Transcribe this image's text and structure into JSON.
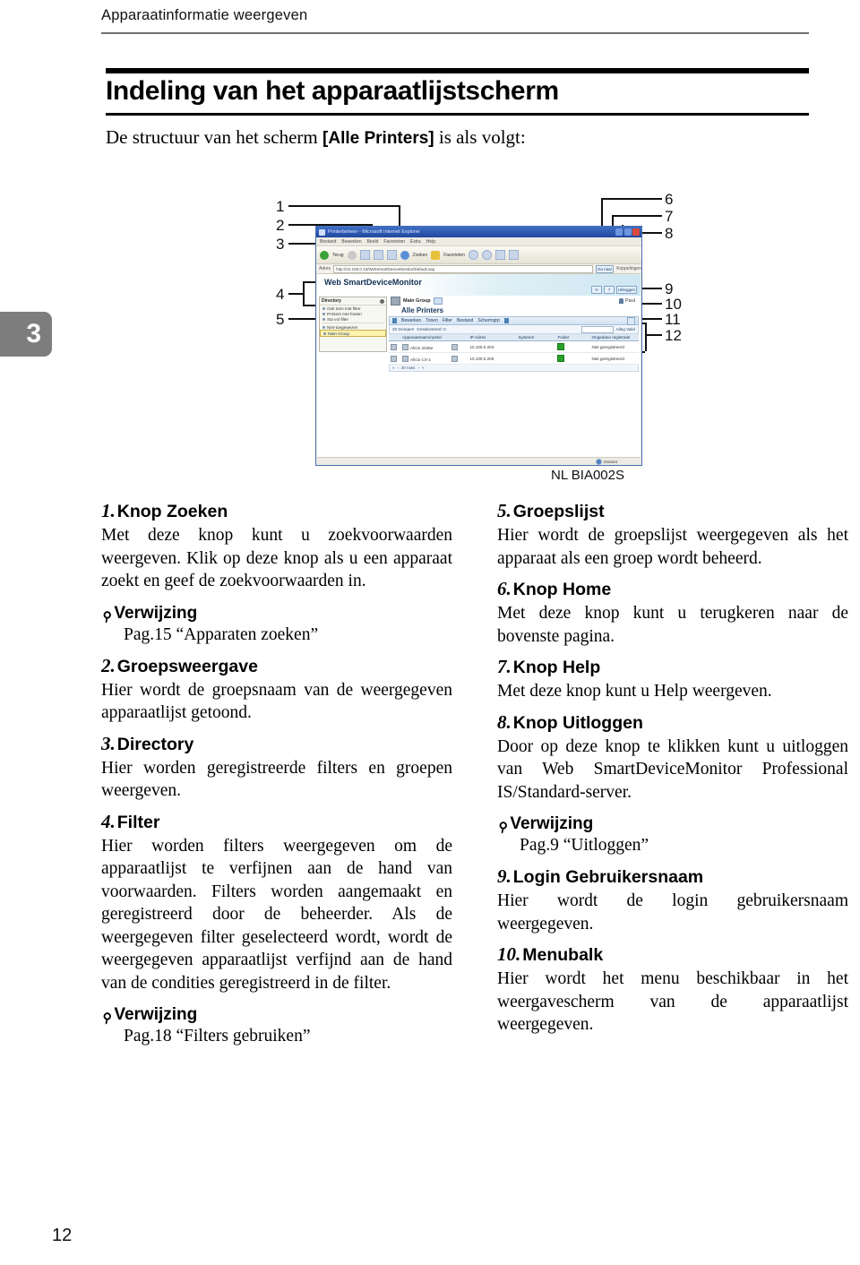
{
  "running_header": "Apparaatinformatie weergeven",
  "chapter_tab": "3",
  "chapter_title": "Indeling van het apparaatlijstscherm",
  "intro": {
    "before": "De structuur van het scherm ",
    "bracket": "[Alle Printers]",
    "after": " is als volgt:"
  },
  "figure": {
    "caption": "NL BIA002S",
    "callouts_left": [
      "1",
      "2",
      "3",
      "4",
      "5"
    ],
    "callouts_right": [
      "6",
      "7",
      "8",
      "9",
      "10",
      "11",
      "12"
    ],
    "window": {
      "title": "Printerbeheer - Microsoft Internet Explorer",
      "menus": [
        "Bestand",
        "Bewerken",
        "Beeld",
        "Favorieten",
        "Extra",
        "Help"
      ],
      "toolbar_back": "Terug",
      "toolbar_search": "Zoeken",
      "toolbar_favorites": "Favorieten",
      "address_label": "Adres",
      "address_value": "http://10.100.0.10/WebSmartDeviceMonitor/Default.asp",
      "go_label": "Ga naar",
      "links_label": "Koppelingen",
      "app_logo": "Web SmartDeviceMonitor",
      "btn_home": "H",
      "btn_help": "?",
      "btn_logout": "Uitloggen",
      "login_user": "Paul",
      "directory": {
        "heading": "Directory",
        "items": [
          "Ook toon met filter",
          "Printers met fouten",
          "Sta vol filter",
          "Niet-toegewezen",
          "Main Group"
        ],
        "selected": "Main Group"
      },
      "group_name": "Main Group",
      "list_title": "Alle Printers",
      "menubar": [
        "Bewerken",
        "Tonen",
        "Filter",
        "Bestand",
        "Schermgrp"
      ],
      "pathbar": {
        "groups_label": "20 Groepen",
        "selected_label": "Geselecteerd: 0",
        "search_placeholder": "",
        "search_button": "Alleg Valid"
      },
      "table": {
        "columns": [
          "",
          "Apparaatnaam/opstel",
          "",
          "IP-Adres",
          "Systeem",
          "Folder",
          "Ongedane registratie"
        ],
        "rows": [
          [
            "",
            "Aficio 2045e",
            "",
            "10.100.0.204",
            "",
            "",
            "Niet geregistreerd"
          ],
          [
            "",
            "Aficio CX-1",
            "",
            "10.100.0.205",
            "",
            "",
            "Niet geregistreerd"
          ]
        ]
      },
      "pager": "20 rows",
      "status": "Intranet"
    }
  },
  "left_column": [
    {
      "num": "1.",
      "title": "Knop Zoeken",
      "body": "Met deze knop kunt u zoekvoorwaarden weergeven. Klik op deze knop als u een apparaat zoekt en geef de zoekvoorwaarden in.",
      "ref_head": "Verwijzing",
      "ref_line": "Pag.15 “Apparaten zoeken”"
    },
    {
      "num": "2.",
      "title": "Groepsweergave",
      "body": "Hier wordt de groepsnaam van de weergegeven apparaatlijst getoond."
    },
    {
      "num": "3.",
      "title": "Directory",
      "body": "Hier worden geregistreerde filters en groepen weergeven."
    },
    {
      "num": "4.",
      "title": "Filter",
      "body": "Hier worden filters weergegeven om de apparaatlijst te verfijnen aan de hand van voorwaarden. Filters worden aangemaakt en geregistreerd door de beheerder. Als de weergegeven filter geselecteerd wordt, wordt de weergegeven apparaatlijst verfijnd aan de hand van de condities geregistreerd in de filter.",
      "ref_head": "Verwijzing",
      "ref_line": "Pag.18 “Filters gebruiken”"
    }
  ],
  "right_column": [
    {
      "num": "5.",
      "title": "Groepslijst",
      "body": "Hier wordt de groepslijst weergegeven als het apparaat als een groep wordt beheerd."
    },
    {
      "num": "6.",
      "title": "Knop Home",
      "body": "Met deze knop kunt u terugkeren naar de bovenste pagina."
    },
    {
      "num": "7.",
      "title": "Knop Help",
      "body": "Met deze knop kunt u Help weergeven."
    },
    {
      "num": "8.",
      "title": "Knop Uitloggen",
      "body": "Door op deze knop te klikken kunt u uitloggen van Web SmartDeviceMonitor Professional IS/Standard-server.",
      "ref_head": "Verwijzing",
      "ref_line": "Pag.9 “Uitloggen”"
    },
    {
      "num": "9.",
      "title": "Login Gebruikersnaam",
      "body": "Hier wordt de login gebruikersnaam weergegeven."
    },
    {
      "num": "10.",
      "title": "Menubalk",
      "body": "Hier wordt het menu beschikbaar in het weergavescherm van de apparaatlijst weergegeven."
    }
  ],
  "folio": "12"
}
